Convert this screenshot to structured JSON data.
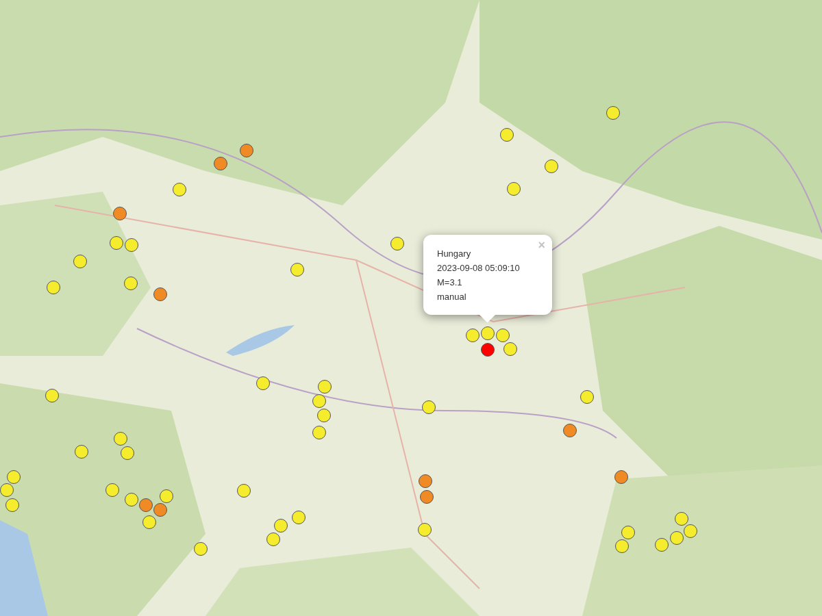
{
  "markers": [
    {
      "color": "#f4ec2c"
    },
    {
      "color": "#f4ec2c"
    },
    {
      "color": "#f4ec2c"
    },
    {
      "color": "#f4ec2c"
    },
    {
      "color": "#f4ec2c"
    },
    {
      "color": "#f4ec2c"
    },
    {
      "color": "#f4ec2c"
    },
    {
      "color": "#f4ec2c"
    },
    {
      "color": "#f4ec2c"
    },
    {
      "color": "#f4ec2c"
    },
    {
      "color": "#f4ec2c"
    },
    {
      "color": "#f4ec2c"
    },
    {
      "color": "#f4ec2c"
    },
    {
      "color": "#f4ec2c"
    },
    {
      "color": "#f4ec2c"
    },
    {
      "color": "#f4ec2c"
    },
    {
      "color": "#f4ec2c"
    },
    {
      "color": "#f4ec2c"
    },
    {
      "color": "#f4ec2c"
    },
    {
      "color": "#f4ec2c"
    },
    {
      "color": "#f4ec2c"
    },
    {
      "color": "#f4ec2c"
    },
    {
      "color": "#f4ec2c"
    },
    {
      "color": "#f4ec2c"
    },
    {
      "color": "#f4ec2c"
    },
    {
      "color": "#f4ec2c"
    },
    {
      "color": "#f4ec2c"
    },
    {
      "color": "#f4ec2c"
    },
    {
      "color": "#f4ec2c"
    },
    {
      "color": "#f4ec2c"
    },
    {
      "color": "#f4ec2c"
    },
    {
      "color": "#f4ec2c"
    },
    {
      "color": "#f4ec2c"
    },
    {
      "color": "#f4ec2c"
    },
    {
      "color": "#f4ec2c"
    },
    {
      "color": "#f4ec2c"
    },
    {
      "color": "#f4ec2c"
    },
    {
      "color": "#f4ec2c"
    },
    {
      "color": "#f4ec2c"
    },
    {
      "color": "#f4ec2c"
    },
    {
      "color": "#f4ec2c"
    },
    {
      "color": "#f4ec2c"
    },
    {
      "color": "#f4ec2c"
    },
    {
      "color": "#f4ec2c"
    },
    {
      "color": "#f4ec2c"
    },
    {
      "color": "#f4ec2c"
    },
    {
      "color": "#f08a24"
    },
    {
      "color": "#f08a24"
    },
    {
      "color": "#f08a24"
    },
    {
      "color": "#f08a24"
    },
    {
      "color": "#f08a24"
    },
    {
      "color": "#f08a24"
    },
    {
      "color": "#f08a24"
    },
    {
      "color": "#f08a24"
    },
    {
      "color": "#f08a24"
    },
    {
      "color": "#f08a24"
    },
    {
      "color": "#ff0000"
    }
  ],
  "popup": {
    "lines": [
      "Hungary",
      "2023-09-08 05:09:10",
      "M=3.1",
      "manual"
    ],
    "close": "×"
  }
}
